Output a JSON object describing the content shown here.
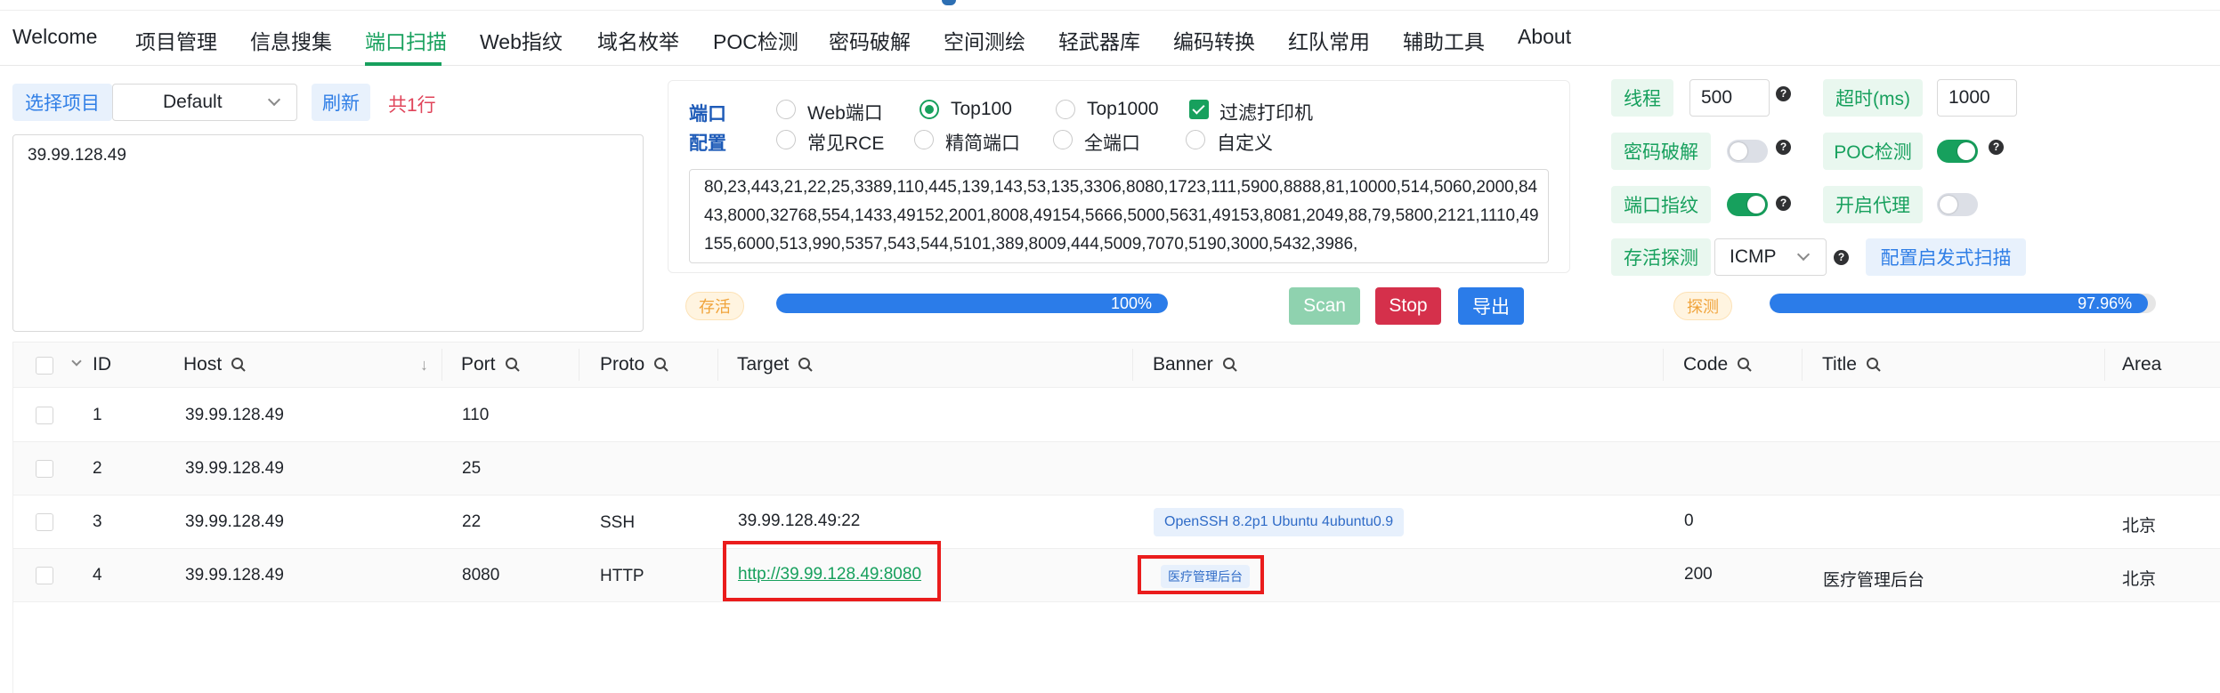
{
  "nav": {
    "items": [
      "Welcome",
      "项目管理",
      "信息搜集",
      "端口扫描",
      "Web指纹",
      "域名枚举",
      "POC检测",
      "密码破解",
      "空间测绘",
      "轻武器库",
      "编码转换",
      "红队常用",
      "辅助工具",
      "About"
    ],
    "active_index": 3
  },
  "project": {
    "select_label": "选择项目",
    "selected": "Default",
    "refresh": "刷新",
    "count": "共1行",
    "targets": "39.99.128.49"
  },
  "port_config": {
    "label1": "端口",
    "label2": "配置",
    "options": [
      "Web端口",
      "Top100",
      "Top1000",
      "过滤打印机",
      "常见RCE",
      "精简端口",
      "全端口",
      "自定义"
    ],
    "selected_option": "Top100",
    "ports_list": "80,23,443,21,22,25,3389,110,445,139,143,53,135,3306,8080,1723,111,5900,8888,81,10000,514,5060,2000,8443,8000,32768,554,1433,49152,2001,8008,49154,5666,5000,5631,49153,8081,2049,88,79,5800,2121,1110,49155,6000,513,990,5357,543,544,5101,389,8009,444,5009,7070,5190,3000,5432,3986,"
  },
  "alive_tag": "存活",
  "alive_progress": {
    "value": 100,
    "label": "100%"
  },
  "buttons": {
    "scan": "Scan",
    "stop": "Stop",
    "export": "导出"
  },
  "settings": {
    "threads_label": "线程",
    "threads": "500",
    "timeout_label": "超时(ms)",
    "timeout": "1000",
    "password_label": "密码破解",
    "password_on": false,
    "poc_label": "POC检测",
    "poc_on": true,
    "fingerprint_label": "端口指纹",
    "fingerprint_on": true,
    "proxy_label": "开启代理",
    "proxy_on": false,
    "alive_label": "存活探测",
    "alive_mode": "ICMP",
    "heuristic_label": "配置启发式扫描"
  },
  "probe_tag": "探测",
  "probe_progress": {
    "value": 97.96,
    "label": "97.96%"
  },
  "table": {
    "columns": [
      "ID",
      "Host",
      "Port",
      "Proto",
      "Target",
      "Banner",
      "Code",
      "Title",
      "Area"
    ],
    "rows": [
      {
        "id": "1",
        "host": "39.99.128.49",
        "port": "110",
        "proto": "",
        "target": "",
        "banner": "",
        "code": "",
        "title": "",
        "area": ""
      },
      {
        "id": "2",
        "host": "39.99.128.49",
        "port": "25",
        "proto": "",
        "target": "",
        "banner": "",
        "code": "",
        "title": "",
        "area": ""
      },
      {
        "id": "3",
        "host": "39.99.128.49",
        "port": "22",
        "proto": "SSH",
        "target": "39.99.128.49:22",
        "banner": "OpenSSH 8.2p1 Ubuntu 4ubuntu0.9",
        "code": "0",
        "title": "",
        "area": "北京"
      },
      {
        "id": "4",
        "host": "39.99.128.49",
        "port": "8080",
        "proto": "HTTP",
        "target": "http://39.99.128.49:8080",
        "banner": "医疗管理后台",
        "code": "200",
        "title": "医疗管理后台",
        "area": "北京"
      }
    ]
  },
  "colors": {
    "accent": "#17a05d",
    "primary": "#2b7ce9",
    "danger": "#d5304b",
    "highlight": "#ea1c1c"
  }
}
